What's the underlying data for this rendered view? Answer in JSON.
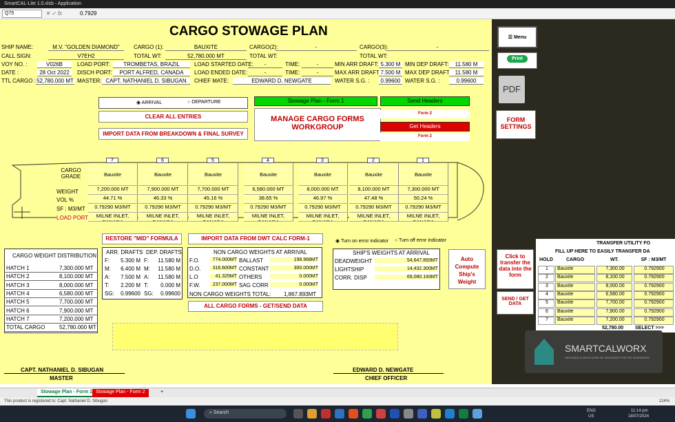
{
  "app": {
    "title": "SmartCAL-Lite 1.0.xlsb - Application",
    "namebox": "Q75",
    "formula": "0.7929"
  },
  "title": "CARGO STOWAGE PLAN",
  "header": {
    "ship_name_l": "SHIP NAME:",
    "ship_name": "M.V. \"GOLDEN DIAMOND\"",
    "cargo1_l": "CARGO (1):",
    "cargo1": "BAUXITE",
    "cargo2_l": "CARGO(2):",
    "cargo3_l": "CARGO(3):",
    "dash": "-",
    "call_sign_l": "CALL SIGN:",
    "call_sign": "V7EH2",
    "total_wt_l": "TOTAL WT:",
    "total_wt": "52,780.000 MT",
    "total_wt2_l": "TOTAL WT:",
    "total_wt3_l": "TOTAL WT:",
    "voy_l": "VOY NO. :",
    "voy": "V026B",
    "load_port_l": "LOAD PORT:",
    "load_port": "TROMBETAS, BRAZIL",
    "load_start_l": "LOAD STARTED DATE:",
    "time_l": "TIME:",
    "min_arr_l": "MIN ARR DRAFT:",
    "min_arr": "5.300 M",
    "min_dep_l": "MIN DEP DRAFT:",
    "min_dep": "11.580 M",
    "date_l": "DATE :",
    "date": "28 Oct 2022",
    "disch_l": "DISCH PORT:",
    "disch": "PORT ALFRED, CANADA",
    "load_end_l": "LOAD ENDED DATE:",
    "max_arr_l": "MAX ARR DRAFT:",
    "max_arr": "7.500 M",
    "max_dep_l": "MAX DEP DRAFT:",
    "max_dep": "11.580 M",
    "ttl_cargo_l": "TTL CARGO :",
    "ttl_cargo": "52,780.000 MT",
    "master_l": "MASTER:",
    "master": "CAPT. NATHANIEL D. SIBUGAN",
    "chief_l": "CHIEF MATE:",
    "chief": "EDWARD D. NEWGATE",
    "water_l": "WATER S.G. :",
    "water": "0.99600",
    "water2": "0.99600"
  },
  "radio": {
    "arrival": "ARRIVAL",
    "departure": "DEPARTURE",
    "err_on": "Turn on error indicator",
    "err_off": "Turn off error indicator"
  },
  "buttons": {
    "clear": "CLEAR ALL ENTRIES",
    "import_bd": "IMPORT DATA FROM BREAKDOWN & FINAL SURVEY",
    "manage": "MANAGE CARGO FORMS WORKGROUP",
    "stow1": "Stowage Plan - Form 1",
    "send_headers": "Send Headers",
    "form2": "Form 2",
    "get_headers": "Get Headers",
    "restore": "RESTORE \"MID\" FORMULA",
    "import_dwt": "IMPORT DATA FROM DWT CALC FORM-1",
    "all_forms": "ALL CARGO FORMS - GET/SEND DATA",
    "auto": "Auto Compute Ship's Weight",
    "click_transfer": "Click to transfer the data into the form",
    "send_get": "SEND / GET DATA",
    "menu": "Menu",
    "print": "Print",
    "pdf": "PDF",
    "settings": "FORM SETTINGS"
  },
  "holds": {
    "row_labels": [
      "CARGO GRADE",
      "WEIGHT",
      "VOL %",
      "SF : M3/MT",
      "LOAD PORT"
    ],
    "items": [
      {
        "no": "7",
        "grade": "Bauxite",
        "weight": "7,200.000 MT",
        "vol": "44.71 %",
        "sf": "0.79290 M3/MT",
        "port": "MILNE INLET, CANADA"
      },
      {
        "no": "6",
        "grade": "Bauxite",
        "weight": "7,900.000 MT",
        "vol": "46.33 %",
        "sf": "0.79290 M3/MT",
        "port": "MILNE INLET, CANADA"
      },
      {
        "no": "5",
        "grade": "Bauxite",
        "weight": "7,700.000 MT",
        "vol": "45.16 %",
        "sf": "0.79290 M3/MT",
        "port": "MILNE INLET, CANADA"
      },
      {
        "no": "4",
        "grade": "Bauxite",
        "weight": "6,580.000 MT",
        "vol": "38.65 %",
        "sf": "0.79290 M3/MT",
        "port": "MILNE INLET, CANADA"
      },
      {
        "no": "3",
        "grade": "Bauxite",
        "weight": "8,000.000 MT",
        "vol": "46.97 %",
        "sf": "0.79290 M3/MT",
        "port": "MILNE INLET, CANADA"
      },
      {
        "no": "2",
        "grade": "Bauxite",
        "weight": "8,100.000 MT",
        "vol": "47.48 %",
        "sf": "0.79290 M3/MT",
        "port": "MILNE INLET, CANADA"
      },
      {
        "no": "1",
        "grade": "Bauxite",
        "weight": "7,300.000 MT",
        "vol": "50.24 %",
        "sf": "0.79290 M3/MT",
        "port": "MILNE INLET, CANADA"
      }
    ]
  },
  "dist": {
    "title": "CARGO WEIGHT DISTRIBUTION",
    "rows": [
      [
        "HATCH 1",
        "7,300.000 MT"
      ],
      [
        "HATCH 2",
        "8,100.000 MT"
      ],
      [
        "HATCH 3",
        "8,000.000 MT"
      ],
      [
        "HATCH 4",
        "6,580.000 MT"
      ],
      [
        "HATCH 5",
        "7,700.000 MT"
      ],
      [
        "HATCH 6",
        "7,900.000 MT"
      ],
      [
        "HATCH 7",
        "7,200.000 MT"
      ],
      [
        "TOTAL CARGO",
        "52,780.000 MT"
      ]
    ]
  },
  "drafts": {
    "arr_h": "ARR. DRAFTS",
    "dep_h": "DEP. DRAFTS",
    "rows": [
      [
        "F:",
        "5.300 M",
        "F:",
        "11.580 M"
      ],
      [
        "M:",
        "6.400 M",
        "M:",
        "11.580 M"
      ],
      [
        "A:",
        "7.500 M",
        "A:",
        "11.580 M"
      ],
      [
        "T:",
        "2.200 M",
        "T:",
        "0.000 M"
      ],
      [
        "SG:",
        "0.99600",
        "SG:",
        "0.99600"
      ]
    ]
  },
  "noncargo": {
    "title": "NON CARGO WEIGHTS AT ARRIVAL",
    "rows": [
      [
        "F.O.",
        "774.000MT",
        "BALLAST",
        "198.968MT"
      ],
      [
        "D.O.",
        "316.600MT",
        "CONSTANT",
        "300.000MT"
      ],
      [
        "L.O",
        "41.325MT",
        "OTHERS",
        "0.000MT"
      ],
      [
        "F.W.",
        "237.000MT",
        "SAG CORR",
        "0.000MT"
      ]
    ],
    "total_l": "NON CARGO WEIGHTS TOTAL:",
    "total": "1,867.893MT"
  },
  "shipw": {
    "title": "SHIP'S WEIGHTS AT ARRIVAL",
    "rows": [
      [
        "DEADWEIGHT",
        "54,647.893MT"
      ],
      [
        "LIGHTSHIP",
        "14,432.300MT"
      ],
      [
        "CORR. DISP",
        "69,080.193MT"
      ]
    ]
  },
  "sign": {
    "master": "CAPT. NATHANIEL D. SIBUGAN",
    "master_t": "MASTER",
    "chief": "EDWARD D. NEWGATE",
    "chief_t": "CHIEF OFFICER"
  },
  "transfer": {
    "title": "TRANSFER UTILITY FO",
    "sub": "FILL UP HERE TO EASILY TRANSFER DA",
    "heads": [
      "HOLD",
      "CARGO",
      "WT.",
      "SF : M3/MT"
    ],
    "rows": [
      [
        "1",
        "Bauxite",
        "7,300.00",
        "0.792900"
      ],
      [
        "2",
        "Bauxite",
        "8,100.00",
        "0.792900"
      ],
      [
        "3",
        "Bauxite",
        "8,000.00",
        "0.792900"
      ],
      [
        "4",
        "Bauxite",
        "6,580.00",
        "0.792900"
      ],
      [
        "5",
        "Bauxite",
        "7,700.00",
        "0.792900"
      ],
      [
        "6",
        "Bauxite",
        "7,900.00",
        "0.792900"
      ],
      [
        "7",
        "Bauxite",
        "7,200.00",
        "0.792900"
      ]
    ],
    "total": "52,780.00",
    "select": "SELECT >>>"
  },
  "logo": {
    "name": "SMARTCALWORX",
    "tag": "DESIGNED & DEVELOPED BY SEAFARER FOR THE SEAFARERS"
  },
  "tabs": [
    "Stowage Plan - Form 1",
    "Stowage Plan - Form 2",
    "+"
  ],
  "status": "This product is registered to: Capt. Nathaniel D. Sibugan",
  "zoom": "124%",
  "taskbar": {
    "search": "Search",
    "lang1": "ENG",
    "lang2": "US",
    "time": "11:14 pm",
    "date": "18/07/2024"
  },
  "colors": {
    "sheet": "#ffff99",
    "green": "#00d800",
    "red": "#e00000",
    "accent": "#c00000"
  }
}
